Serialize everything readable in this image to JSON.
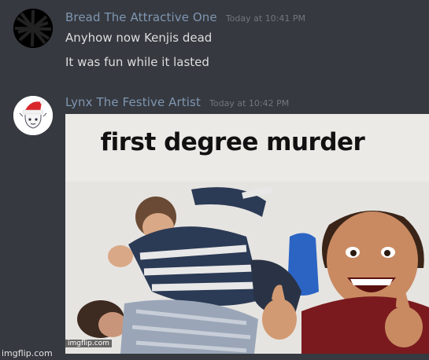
{
  "messages": [
    {
      "author": "Bread The Attractive One",
      "timestamp": "Today at 10:41 PM",
      "lines": [
        "Anyhow now Kenjis dead",
        "It was fun while it lasted"
      ]
    },
    {
      "author": "Lynx The Festive Artist",
      "timestamp": "Today at 10:42 PM",
      "attachment": {
        "caption": "first degree murder",
        "watermark": "imgflip.com"
      }
    }
  ],
  "footer_watermark": "imgflip.com",
  "colors": {
    "background": "#36393f",
    "username": "#7f96b2",
    "timestamp": "#72767d",
    "message_text": "#dcddde"
  }
}
